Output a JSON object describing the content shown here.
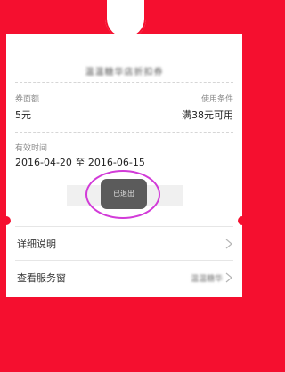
{
  "coupon": {
    "title": "温温糖华店折扣券",
    "amount_label": "券面额",
    "amount_value": "5元",
    "condition_label": "使用条件",
    "condition_value": "满38元可用",
    "validity_label": "有效时间",
    "validity_value": "2016-04-20 至 2016-06-15",
    "status_button": "已退出"
  },
  "rows": [
    {
      "label": "详细说明",
      "hint": ""
    },
    {
      "label": "查看服务窗",
      "hint": "温温糖华"
    }
  ],
  "colors": {
    "background": "#f50f2f",
    "card": "#ffffff",
    "button": "#5b5b5b",
    "annotation": "#d23bd8"
  },
  "icons": [
    "chevron-right-icon"
  ]
}
